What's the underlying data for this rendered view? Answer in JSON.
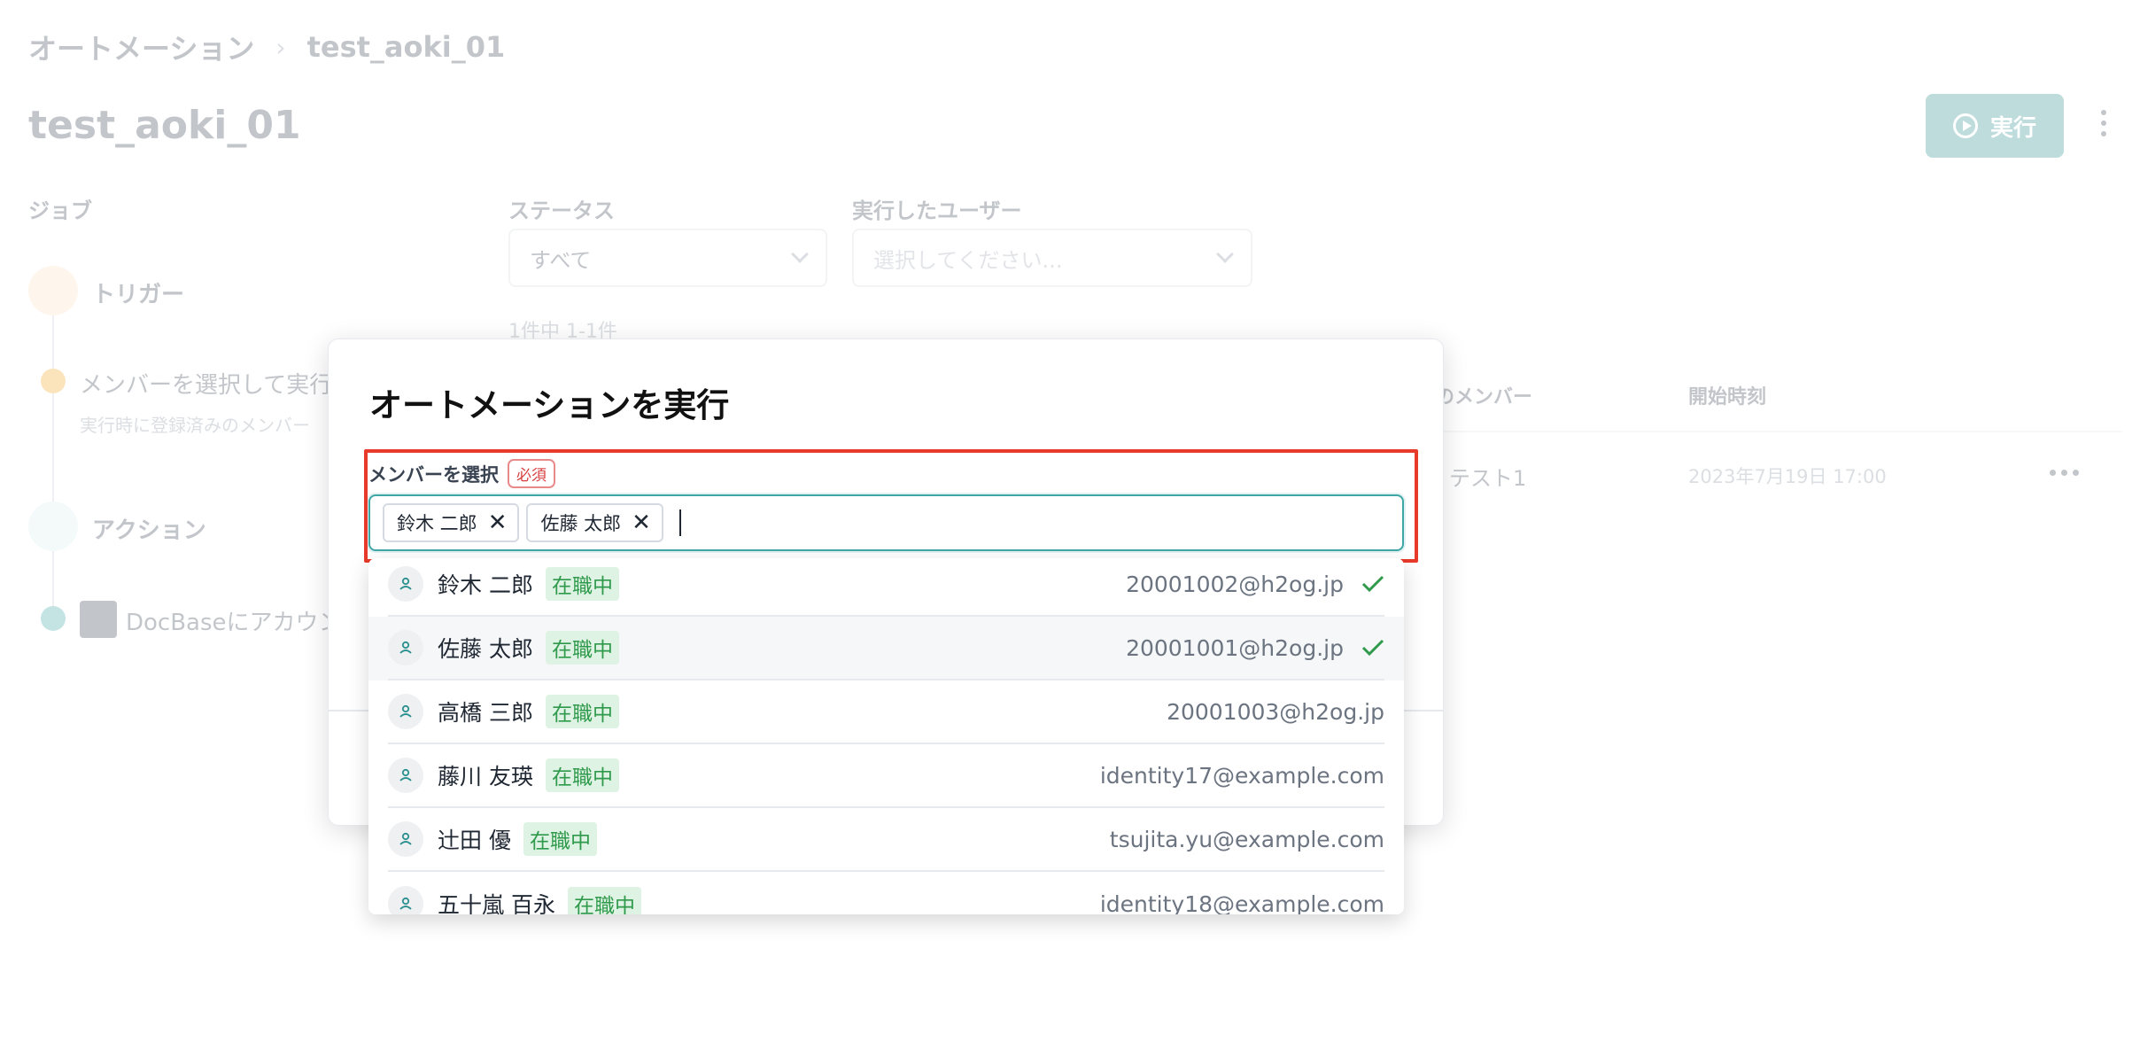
{
  "breadcrumb": {
    "root": "オートメーション",
    "current": "test_aoki_01"
  },
  "page": {
    "title": "test_aoki_01",
    "run_button": "実行"
  },
  "jobs": {
    "section_label": "ジョブ",
    "trigger_label": "トリガー",
    "trigger_item": "メンバーを選択して実行",
    "trigger_sub": "実行時に登録済みのメンバー",
    "action_label": "アクション",
    "action_item": "DocBaseにアカウン"
  },
  "filters": {
    "status_label": "ステータス",
    "status_value": "すべて",
    "user_label": "実行したユーザー",
    "user_placeholder": "選択してください..."
  },
  "results": {
    "count": "1件中 1-1件"
  },
  "table": {
    "col_member": "のメンバー",
    "col_start": "開始時刻",
    "row_member": "テスト1",
    "row_start": "2023年7月19日 17:00"
  },
  "modal": {
    "title": "オートメーションを実行",
    "field_label": "メンバーを選択",
    "required_badge": "必須",
    "selected": [
      "鈴木 二郎",
      "佐藤 太郎"
    ]
  },
  "options": [
    {
      "name": "鈴木 二郎",
      "status": "在職中",
      "email": "20001002@h2og.jp",
      "checked": true
    },
    {
      "name": "佐藤 太郎",
      "status": "在職中",
      "email": "20001001@h2og.jp",
      "checked": true
    },
    {
      "name": "高橋 三郎",
      "status": "在職中",
      "email": "20001003@h2og.jp",
      "checked": false
    },
    {
      "name": "藤川 友瑛",
      "status": "在職中",
      "email": "identity17@example.com",
      "checked": false
    },
    {
      "name": "辻田 優",
      "status": "在職中",
      "email": "tsujita.yu@example.com",
      "checked": false
    },
    {
      "name": "五十嵐 百永",
      "status": "在職中",
      "email": "identity18@example.com",
      "checked": false
    }
  ],
  "colors": {
    "accent": "#3fa6a6",
    "highlight": "#e83a2a",
    "status_green": "#2f9a4c",
    "check_green": "#2f9a4c"
  }
}
